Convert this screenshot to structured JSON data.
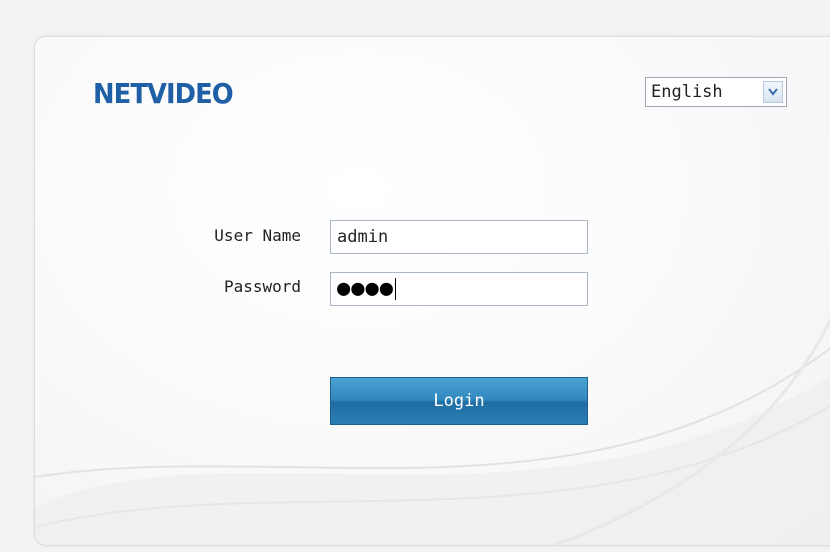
{
  "header": {
    "logo_text": "NETVIDEO"
  },
  "language": {
    "selected": "English",
    "arrow_icon": "chevron-down-icon"
  },
  "form": {
    "username_label": "User Name",
    "username_value": "admin",
    "password_label": "Password",
    "password_masked": "●●●●",
    "login_label": "Login"
  },
  "colors": {
    "brand": "#1f5fa6",
    "button": "#2f87bd"
  }
}
